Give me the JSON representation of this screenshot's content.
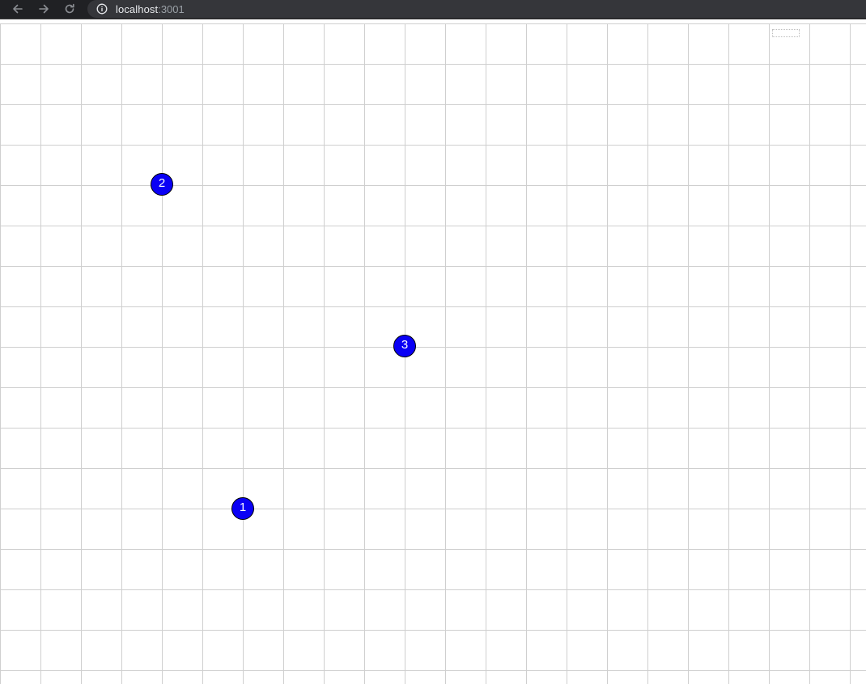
{
  "browser": {
    "address": {
      "host": "localhost",
      "port": ":3001"
    },
    "icons": {
      "back": "arrow-left-icon",
      "forward": "arrow-right-icon",
      "reload": "reload-icon",
      "site_info": "info-icon"
    }
  },
  "canvas": {
    "grid_color": "#cfcfcf",
    "background": "#ffffff",
    "markers": [
      {
        "label": "1",
        "color": "#0a00f5"
      },
      {
        "label": "2",
        "color": "#0a00f5"
      },
      {
        "label": "3",
        "color": "#0a00f5"
      }
    ]
  }
}
